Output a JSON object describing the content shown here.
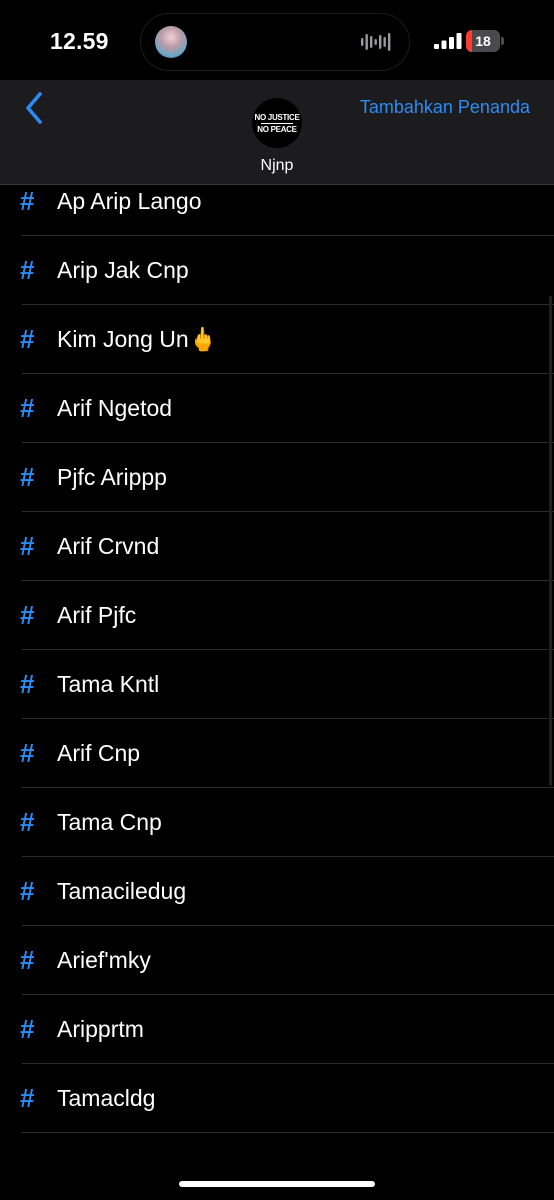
{
  "status_bar": {
    "time": "12.59",
    "battery_level": "18",
    "battery_fraction": 0.18
  },
  "nav": {
    "back_icon": "chevron-left-icon",
    "avatar_logo": [
      "NO JUSTICE",
      "NO PEACE"
    ],
    "channel_name": "Njnp",
    "add_bookmark_label": "Tambahkan Penanda"
  },
  "list": {
    "icon": "hash-icon",
    "items": [
      {
        "label": "Ap Arip Lango"
      },
      {
        "label": "Arip Jak Cnp"
      },
      {
        "label": "Kim Jong Un🖕"
      },
      {
        "label": "Arif Ngetod"
      },
      {
        "label": "Pjfc Arippp"
      },
      {
        "label": "Arif Crvnd"
      },
      {
        "label": "Arif Pjfc"
      },
      {
        "label": "Tama Kntl"
      },
      {
        "label": "Arif Cnp"
      },
      {
        "label": "Tama Cnp"
      },
      {
        "label": "Tamaciledug"
      },
      {
        "label": "Arief'mky"
      },
      {
        "label": "Aripprtm"
      },
      {
        "label": "Tamacldg"
      }
    ]
  },
  "colors": {
    "accent": "#2b8cf5",
    "background": "#000000",
    "header": "#1c1c1e",
    "battery_low": "#ff3b30"
  }
}
